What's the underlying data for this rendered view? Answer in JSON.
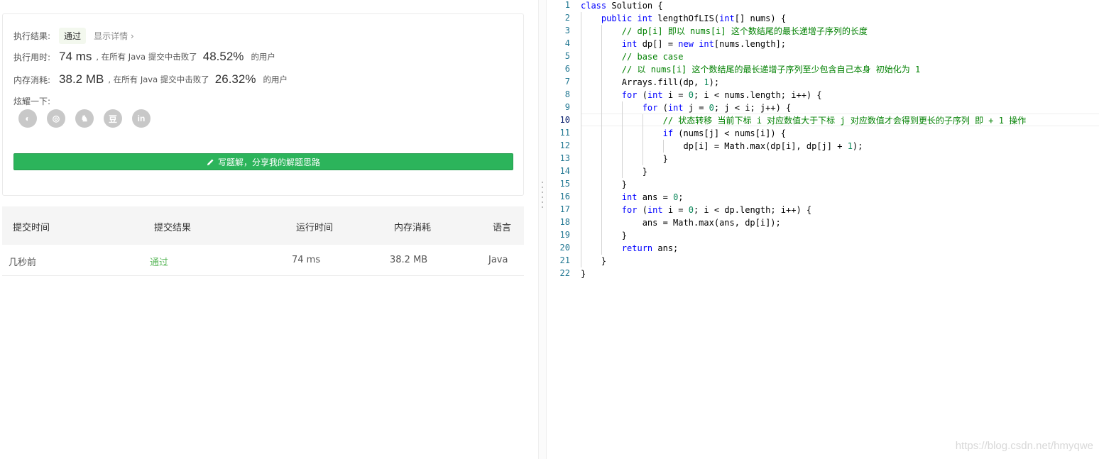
{
  "result": {
    "status_label": "执行结果:",
    "status_value": "通过",
    "details_link": "显示详情 ›",
    "time_label": "执行用时:",
    "time_value": "74 ms",
    "time_beat_prefix": ", 在所有 Java 提交中击败了",
    "time_percent": "48.52%",
    "time_beat_suffix": "的用户",
    "memory_label": "内存消耗:",
    "memory_value": "38.2 MB",
    "memory_beat_prefix": ", 在所有 Java 提交中击败了",
    "memory_percent": "26.32%",
    "memory_beat_suffix": "的用户",
    "share_label": "炫耀一下:",
    "share_icons": [
      "wechat-icon",
      "weibo-icon",
      "qq-icon",
      "douban-icon",
      "linkedin-icon"
    ],
    "share_glyphs": [
      "◐",
      "◎",
      "♞",
      "豆",
      "in"
    ],
    "write_button": "写题解，分享我的解题思路"
  },
  "submissions": {
    "headers": [
      "提交时间",
      "提交结果",
      "运行时间",
      "内存消耗",
      "语言"
    ],
    "rows": [
      {
        "time": "几秒前",
        "result": "通过",
        "runtime": "74 ms",
        "memory": "38.2 MB",
        "language": "Java"
      }
    ]
  },
  "editor": {
    "active_line": 10,
    "lines": [
      "class Solution {",
      "    public int lengthOfLIS(int[] nums) {",
      "        // dp[i] 即以 nums[i] 这个数结尾的最长递增子序列的长度",
      "        int dp[] = new int[nums.length];",
      "        // base case",
      "        // 以 nums[i] 这个数结尾的最长递增子序列至少包含自己本身 初始化为 1",
      "        Arrays.fill(dp, 1);",
      "        for (int i = 0; i < nums.length; i++) {",
      "            for (int j = 0; j < i; j++) {",
      "                // 状态转移 当前下标 i 对应数值大于下标 j 对应数值才会得到更长的子序列 即 + 1 操作",
      "                if (nums[j] < nums[i]) {",
      "                    dp[i] = Math.max(dp[i], dp[j] + 1);",
      "                }",
      "            }",
      "        }",
      "        int ans = 0;",
      "        for (int i = 0; i < dp.length; i++) {",
      "            ans = Math.max(ans, dp[i]);",
      "        }",
      "        return ans;",
      "    }",
      "}"
    ]
  },
  "watermark": "https://blog.csdn.net/hmyqwe",
  "colors": {
    "accent_green": "#2cb45b",
    "pass_green": "#5cb85c",
    "keyword_blue": "#0000ff",
    "comment_green": "#008000",
    "number_green": "#098658",
    "line_number": "#237893"
  }
}
